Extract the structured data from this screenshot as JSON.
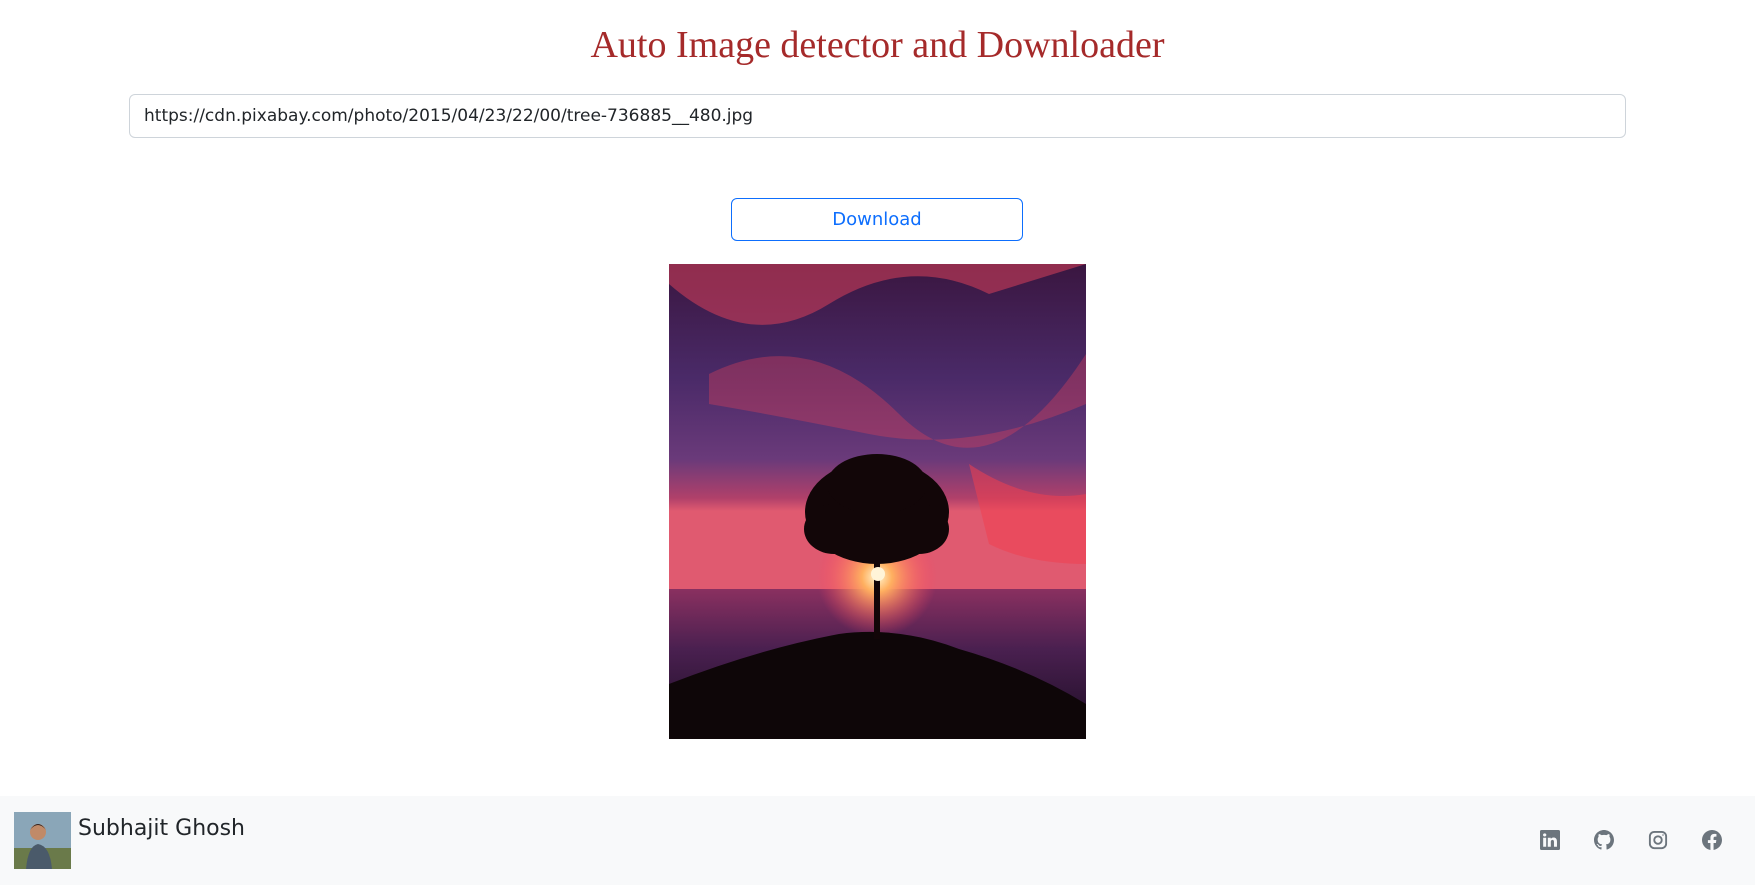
{
  "header": {
    "title": "Auto Image detector and Downloader"
  },
  "form": {
    "url_value": "https://cdn.pixabay.com/photo/2015/04/23/22/00/tree-736885__480.jpg",
    "download_label": "Download"
  },
  "footer": {
    "author_name": "Subhajit Ghosh",
    "social_icons": [
      "linkedin-icon",
      "github-icon",
      "instagram-icon",
      "facebook-icon"
    ]
  },
  "colors": {
    "title": "#a52a2a",
    "primary": "#0d6efd",
    "footer_bg": "#f8f9fa",
    "icon": "#6c757d"
  }
}
